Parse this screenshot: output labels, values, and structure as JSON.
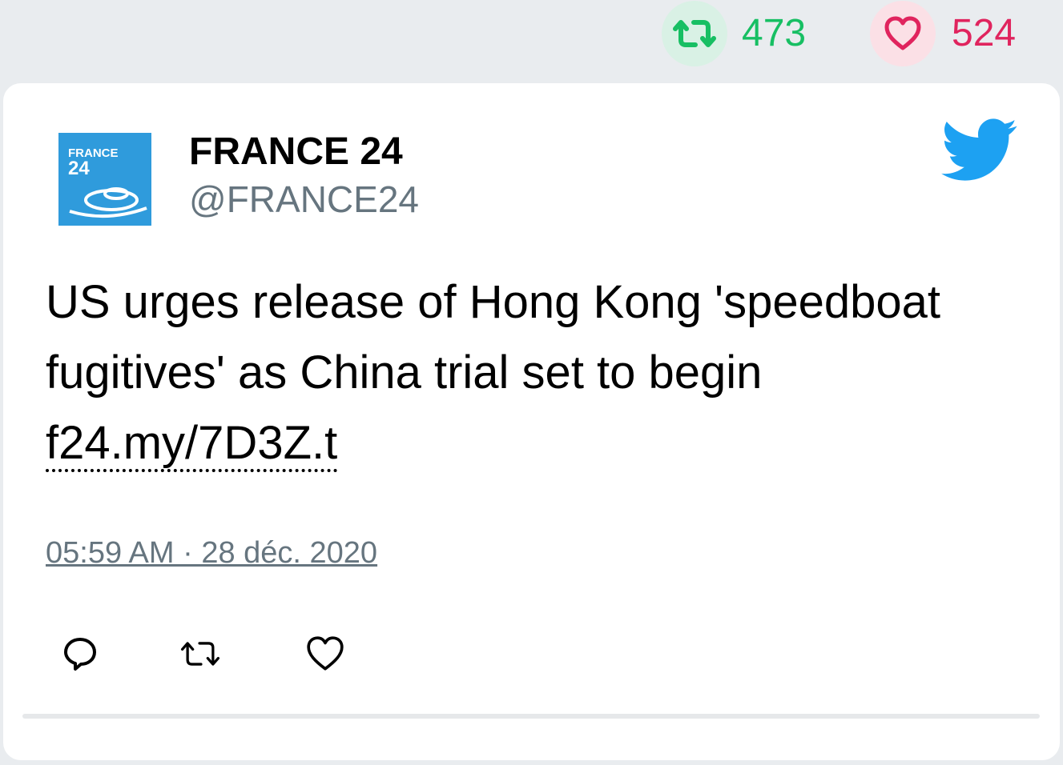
{
  "stats": {
    "retweet_count": "473",
    "like_count": "524",
    "retweet_icon": "retweet-icon",
    "like_icon": "heart-icon",
    "retweet_color": "#17bf63",
    "like_color": "#e0245e"
  },
  "tweet": {
    "author_name": "FRANCE 24",
    "author_handle": "@FRANCE24",
    "avatar_logo_text_line1": "FRANCE",
    "avatar_logo_text_line2": "24",
    "text": "US urges release of Hong Kong 'speedboat fugitives' as China trial set to begin ",
    "link_text": "f24.my/7D3Z.t",
    "timestamp": "05:59 AM · 28 déc. 2020",
    "brand_icon": "twitter-bird-icon",
    "brand_color": "#1da1f2"
  },
  "actions": {
    "reply_icon": "reply-icon",
    "retweet_icon": "retweet-icon",
    "like_icon": "heart-icon"
  }
}
